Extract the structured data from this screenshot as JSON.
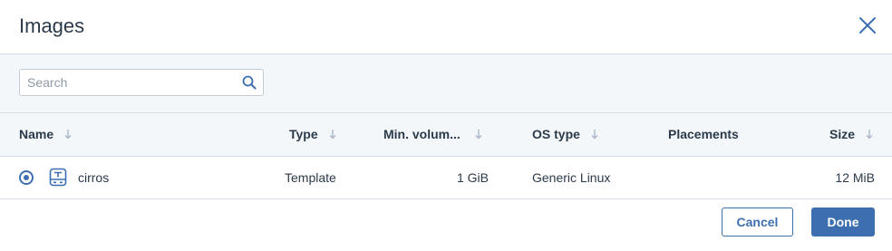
{
  "dialog": {
    "title": "Images"
  },
  "search": {
    "placeholder": "Search",
    "value": ""
  },
  "table": {
    "columns": [
      {
        "key": "name",
        "label": "Name",
        "sortable": true
      },
      {
        "key": "type",
        "label": "Type",
        "sortable": true
      },
      {
        "key": "min_volume",
        "label": "Min. volum...",
        "sortable": true
      },
      {
        "key": "os_type",
        "label": "OS type",
        "sortable": true
      },
      {
        "key": "placements",
        "label": "Placements",
        "sortable": false
      },
      {
        "key": "size",
        "label": "Size",
        "sortable": true
      }
    ],
    "rows": [
      {
        "selected": true,
        "icon": "template-icon",
        "name": "cirros",
        "type": "Template",
        "min_volume": "1 GiB",
        "os_type": "Generic Linux",
        "placements": "",
        "size": "12 MiB"
      }
    ]
  },
  "footer": {
    "cancel_label": "Cancel",
    "done_label": "Done"
  },
  "colors": {
    "accent": "#3d6fb0",
    "header_bg": "#f4f7fa",
    "border": "#d6dde5",
    "sort_icon": "#a9b8ca"
  }
}
